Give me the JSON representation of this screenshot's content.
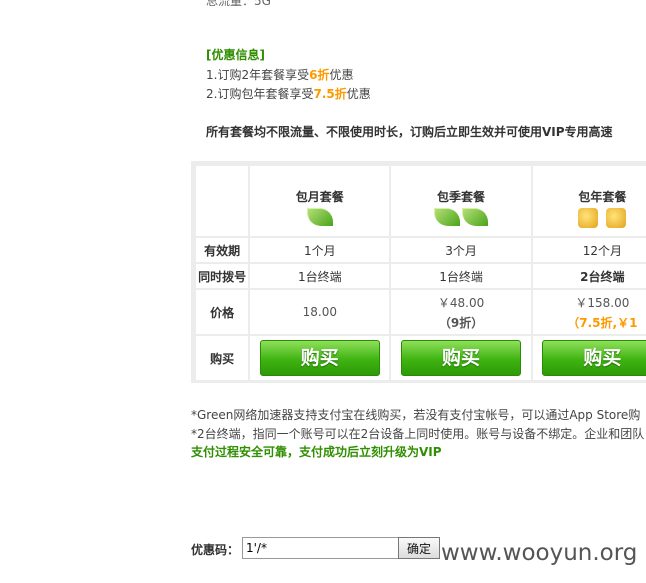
{
  "top_cut_text": "总流量：5G",
  "promo": {
    "title": "[优惠信息]",
    "line1_pre": "1.订购2年套餐享受",
    "line1_hl": "6折",
    "line1_post": "优惠",
    "line2_pre": "2.订购包年套餐享受",
    "line2_hl": "7.5折",
    "line2_post": "优惠"
  },
  "all_plans_note": "所有套餐均不限流量、不限使用时长，订购后立即生效并可使用VIP专用高速",
  "table": {
    "row_labels": [
      "有效期",
      "同时拨号",
      "价格",
      "购买"
    ],
    "plans": [
      {
        "name": "包月套餐",
        "period": "1个月",
        "devices": "1台终端",
        "price": "18.00",
        "discount": "",
        "buy": "购买"
      },
      {
        "name": "包季套餐",
        "period": "3个月",
        "devices": "1台终端",
        "price": "￥48.00",
        "discount": "（9折）",
        "buy": "购买"
      },
      {
        "name": "包年套餐",
        "period": "12个月",
        "devices": "2台终端",
        "price": "￥158.00",
        "discount": "（7.5折,￥1",
        "buy": "购买"
      }
    ]
  },
  "notes": {
    "line1": "*Green网络加速器支持支付宝在线购买，若没有支付宝帐号，可以通过App Store购",
    "line2": "*2台终端，指同一个账号可以在2台设备上同时使用。账号与设备不绑定。企业和团队",
    "green": "支付过程安全可靠，支付成功后立刻升级为VIP"
  },
  "coupon": {
    "label": "优惠码：",
    "value": "1'/*",
    "confirm": "确定"
  },
  "watermark": "www.wooyun.org",
  "colors": {
    "accent_green": "#2f8f00",
    "highlight_orange": "#ff9900",
    "button_green": "#3fb312"
  },
  "icons": {
    "monthly": "leaf-icon",
    "quarterly": "leaf-icon",
    "yearly": "thumbs-up-icon"
  }
}
